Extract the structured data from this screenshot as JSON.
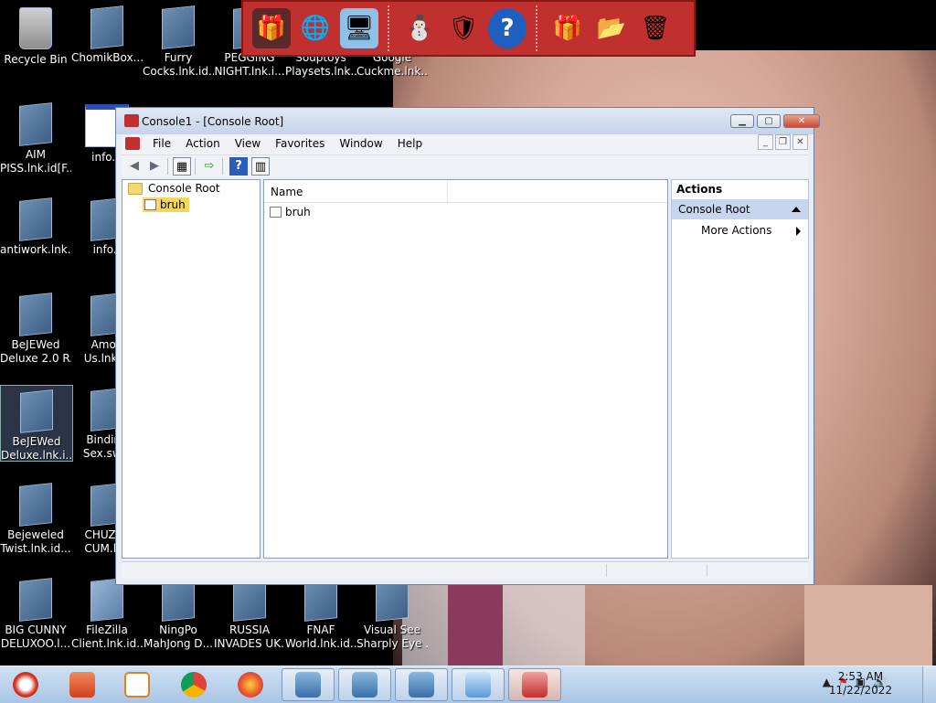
{
  "desktop": {
    "icons": [
      {
        "label_1": "Recycle Bin",
        "label_2": ""
      },
      {
        "label_1": "ChomikBox....",
        "label_2": ""
      },
      {
        "label_1": "Furry",
        "label_2": "Cocks.lnk.id..."
      },
      {
        "label_1": "PEGGING",
        "label_2": "NIGHT.lnk.i..."
      },
      {
        "label_1": "Souptoys",
        "label_2": "Playsets.lnk...."
      },
      {
        "label_1": "Google",
        "label_2": "Cuckme.lnk...."
      },
      {
        "label_1": "AIM",
        "label_2": "PISS.lnk.id[F..."
      },
      {
        "label_1": "info.h",
        "label_2": ""
      },
      {
        "label_1": "antiwork.lnk...",
        "label_2": ""
      },
      {
        "label_1": "info.t",
        "label_2": ""
      },
      {
        "label_1": "BeJEWed",
        "label_2": "Deluxe 2.0 R..."
      },
      {
        "label_1": "Amon",
        "label_2": "Us.lnk.ic"
      },
      {
        "label_1": "BeJEWed",
        "label_2": "Deluxe.lnk.i..."
      },
      {
        "label_1": "Binding",
        "label_2": "Sex.swf.l"
      },
      {
        "label_1": "Bejeweled",
        "label_2": "Twist.lnk.id..."
      },
      {
        "label_1": "CHUZZL",
        "label_2": "CUM.lnk"
      },
      {
        "label_1": "BIG CUNNY",
        "label_2": "DELUXOO.l..."
      },
      {
        "label_1": "FileZilla",
        "label_2": "Client.lnk.id..."
      },
      {
        "label_1": "NingPo",
        "label_2": "MahJong D..."
      },
      {
        "label_1": "RUSSIA",
        "label_2": "INVADES UK..."
      },
      {
        "label_1": "FNAF",
        "label_2": "World.lnk.id..."
      },
      {
        "label_1": "Visual See",
        "label_2": "Sharply Eye ..."
      }
    ]
  },
  "window": {
    "title": "Console1 - [Console Root]",
    "menu": [
      "File",
      "Action",
      "View",
      "Favorites",
      "Window",
      "Help"
    ],
    "tree": {
      "root": "Console Root",
      "child": "bruh"
    },
    "list": {
      "column": "Name",
      "items": [
        "bruh"
      ]
    },
    "actions": {
      "header": "Actions",
      "section": "Console Root",
      "more": "More Actions"
    }
  },
  "taskbar": {
    "clock_time": "2:53 AM",
    "clock_date": "11/22/2022"
  },
  "colors": {
    "toolbar_red": "#c0302e",
    "selection_yellow": "#f7d660",
    "actions_section": "#c5d6ee"
  }
}
